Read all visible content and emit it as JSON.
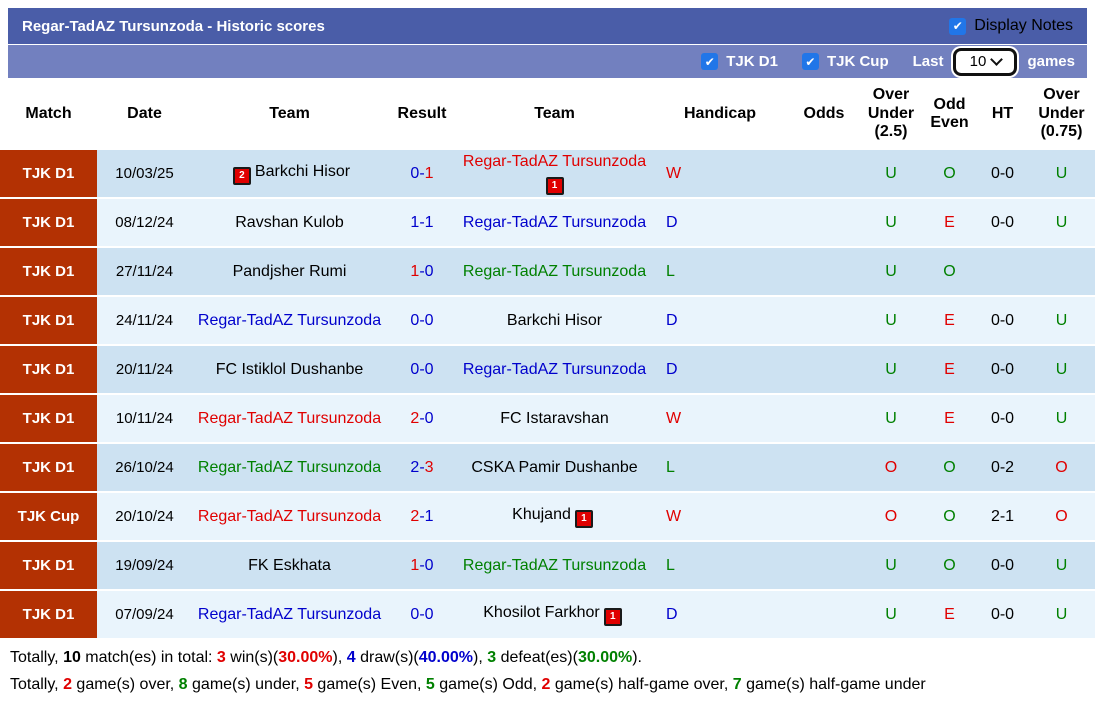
{
  "header": {
    "title": "Regar-TadAZ Tursunzoda - Historic scores",
    "display_notes_label": "Display Notes",
    "display_notes_checked": true
  },
  "filter_bar": {
    "league1_label": "TJK D1",
    "league1_checked": true,
    "league2_label": "TJK Cup",
    "league2_checked": true,
    "last_label": "Last",
    "last_value": "10",
    "games_label": "games"
  },
  "colors": {
    "red": "#e00000",
    "blue": "#0000cc",
    "green": "#008000",
    "black": "#000000",
    "bar_top": "#4a5da8",
    "bar_bottom": "#7280bf",
    "league_cell_bg": "#b33103",
    "row_dark": "#cde2f2",
    "row_light": "#e9f4fc",
    "checkbox_blue": "#2176e8"
  },
  "columns": [
    "Match",
    "Date",
    "Team",
    "Result",
    "Team",
    "Handicap",
    "Odds",
    "Over Under (2.5)",
    "Odd Even",
    "HT",
    "Over Under (0.75)"
  ],
  "rows": [
    {
      "league": "TJK D1",
      "date": "10/03/25",
      "home": {
        "name": "Barkchi Hisor",
        "color": "black",
        "badge": "2",
        "badge_side": "left"
      },
      "result": {
        "home": "0",
        "away": "1",
        "home_color": "blue",
        "away_color": "red"
      },
      "away": {
        "name": "Regar-TadAZ Tursunzoda",
        "color": "red",
        "badge": "1",
        "badge_side": "right"
      },
      "handicap": {
        "text": "W",
        "color": "red"
      },
      "odds": "",
      "ou25": {
        "text": "U",
        "color": "green"
      },
      "odd_even": {
        "text": "O",
        "color": "green"
      },
      "ht": "0-0",
      "ou075": {
        "text": "U",
        "color": "green"
      }
    },
    {
      "league": "TJK D1",
      "date": "08/12/24",
      "home": {
        "name": "Ravshan Kulob",
        "color": "black",
        "badge": null,
        "badge_side": null
      },
      "result": {
        "home": "1",
        "away": "1",
        "home_color": "blue",
        "away_color": "blue"
      },
      "away": {
        "name": "Regar-TadAZ Tursunzoda",
        "color": "blue",
        "badge": null,
        "badge_side": null
      },
      "handicap": {
        "text": "D",
        "color": "blue"
      },
      "odds": "",
      "ou25": {
        "text": "U",
        "color": "green"
      },
      "odd_even": {
        "text": "E",
        "color": "red"
      },
      "ht": "0-0",
      "ou075": {
        "text": "U",
        "color": "green"
      }
    },
    {
      "league": "TJK D1",
      "date": "27/11/24",
      "home": {
        "name": "Pandjsher Rumi",
        "color": "black",
        "badge": null,
        "badge_side": null
      },
      "result": {
        "home": "1",
        "away": "0",
        "home_color": "red",
        "away_color": "blue"
      },
      "away": {
        "name": "Regar-TadAZ Tursunzoda",
        "color": "green",
        "badge": null,
        "badge_side": null
      },
      "handicap": {
        "text": "L",
        "color": "green"
      },
      "odds": "",
      "ou25": {
        "text": "U",
        "color": "green"
      },
      "odd_even": {
        "text": "O",
        "color": "green"
      },
      "ht": "",
      "ou075": {
        "text": "",
        "color": "black"
      }
    },
    {
      "league": "TJK D1",
      "date": "24/11/24",
      "home": {
        "name": "Regar-TadAZ Tursunzoda",
        "color": "blue",
        "badge": null,
        "badge_side": null
      },
      "result": {
        "home": "0",
        "away": "0",
        "home_color": "blue",
        "away_color": "blue"
      },
      "away": {
        "name": "Barkchi Hisor",
        "color": "black",
        "badge": null,
        "badge_side": null
      },
      "handicap": {
        "text": "D",
        "color": "blue"
      },
      "odds": "",
      "ou25": {
        "text": "U",
        "color": "green"
      },
      "odd_even": {
        "text": "E",
        "color": "red"
      },
      "ht": "0-0",
      "ou075": {
        "text": "U",
        "color": "green"
      }
    },
    {
      "league": "TJK D1",
      "date": "20/11/24",
      "home": {
        "name": "FC Istiklol Dushanbe",
        "color": "black",
        "badge": null,
        "badge_side": null
      },
      "result": {
        "home": "0",
        "away": "0",
        "home_color": "blue",
        "away_color": "blue"
      },
      "away": {
        "name": "Regar-TadAZ Tursunzoda",
        "color": "blue",
        "badge": null,
        "badge_side": null
      },
      "handicap": {
        "text": "D",
        "color": "blue"
      },
      "odds": "",
      "ou25": {
        "text": "U",
        "color": "green"
      },
      "odd_even": {
        "text": "E",
        "color": "red"
      },
      "ht": "0-0",
      "ou075": {
        "text": "U",
        "color": "green"
      }
    },
    {
      "league": "TJK D1",
      "date": "10/11/24",
      "home": {
        "name": "Regar-TadAZ Tursunzoda",
        "color": "red",
        "badge": null,
        "badge_side": null
      },
      "result": {
        "home": "2",
        "away": "0",
        "home_color": "red",
        "away_color": "blue"
      },
      "away": {
        "name": "FC Istaravshan",
        "color": "black",
        "badge": null,
        "badge_side": null
      },
      "handicap": {
        "text": "W",
        "color": "red"
      },
      "odds": "",
      "ou25": {
        "text": "U",
        "color": "green"
      },
      "odd_even": {
        "text": "E",
        "color": "red"
      },
      "ht": "0-0",
      "ou075": {
        "text": "U",
        "color": "green"
      }
    },
    {
      "league": "TJK D1",
      "date": "26/10/24",
      "home": {
        "name": "Regar-TadAZ Tursunzoda",
        "color": "green",
        "badge": null,
        "badge_side": null
      },
      "result": {
        "home": "2",
        "away": "3",
        "home_color": "blue",
        "away_color": "red"
      },
      "away": {
        "name": "CSKA Pamir Dushanbe",
        "color": "black",
        "badge": null,
        "badge_side": null
      },
      "handicap": {
        "text": "L",
        "color": "green"
      },
      "odds": "",
      "ou25": {
        "text": "O",
        "color": "red"
      },
      "odd_even": {
        "text": "O",
        "color": "green"
      },
      "ht": "0-2",
      "ou075": {
        "text": "O",
        "color": "red"
      }
    },
    {
      "league": "TJK Cup",
      "date": "20/10/24",
      "home": {
        "name": "Regar-TadAZ Tursunzoda",
        "color": "red",
        "badge": null,
        "badge_side": null
      },
      "result": {
        "home": "2",
        "away": "1",
        "home_color": "red",
        "away_color": "blue"
      },
      "away": {
        "name": "Khujand",
        "color": "black",
        "badge": "1",
        "badge_side": "right"
      },
      "handicap": {
        "text": "W",
        "color": "red"
      },
      "odds": "",
      "ou25": {
        "text": "O",
        "color": "red"
      },
      "odd_even": {
        "text": "O",
        "color": "green"
      },
      "ht": "2-1",
      "ou075": {
        "text": "O",
        "color": "red"
      }
    },
    {
      "league": "TJK D1",
      "date": "19/09/24",
      "home": {
        "name": "FK Eskhata",
        "color": "black",
        "badge": null,
        "badge_side": null
      },
      "result": {
        "home": "1",
        "away": "0",
        "home_color": "red",
        "away_color": "blue"
      },
      "away": {
        "name": "Regar-TadAZ Tursunzoda",
        "color": "green",
        "badge": null,
        "badge_side": null
      },
      "handicap": {
        "text": "L",
        "color": "green"
      },
      "odds": "",
      "ou25": {
        "text": "U",
        "color": "green"
      },
      "odd_even": {
        "text": "O",
        "color": "green"
      },
      "ht": "0-0",
      "ou075": {
        "text": "U",
        "color": "green"
      }
    },
    {
      "league": "TJK D1",
      "date": "07/09/24",
      "home": {
        "name": "Regar-TadAZ Tursunzoda",
        "color": "blue",
        "badge": null,
        "badge_side": null
      },
      "result": {
        "home": "0",
        "away": "0",
        "home_color": "blue",
        "away_color": "blue"
      },
      "away": {
        "name": "Khosilot Farkhor",
        "color": "black",
        "badge": "1",
        "badge_side": "right"
      },
      "handicap": {
        "text": "D",
        "color": "blue"
      },
      "odds": "",
      "ou25": {
        "text": "U",
        "color": "green"
      },
      "odd_even": {
        "text": "E",
        "color": "red"
      },
      "ht": "0-0",
      "ou075": {
        "text": "U",
        "color": "green"
      }
    }
  ],
  "footer": {
    "line1": [
      {
        "t": "Totally, ",
        "c": "black",
        "b": false
      },
      {
        "t": "10",
        "c": "black",
        "b": true
      },
      {
        "t": " match(es) in total: ",
        "c": "black",
        "b": false
      },
      {
        "t": "3",
        "c": "red",
        "b": true
      },
      {
        "t": " win(s)(",
        "c": "black",
        "b": false
      },
      {
        "t": "30.00%",
        "c": "red",
        "b": true
      },
      {
        "t": "), ",
        "c": "black",
        "b": false
      },
      {
        "t": "4",
        "c": "blue",
        "b": true
      },
      {
        "t": " draw(s)(",
        "c": "black",
        "b": false
      },
      {
        "t": "40.00%",
        "c": "blue",
        "b": true
      },
      {
        "t": "), ",
        "c": "black",
        "b": false
      },
      {
        "t": "3",
        "c": "green",
        "b": true
      },
      {
        "t": " defeat(es)(",
        "c": "black",
        "b": false
      },
      {
        "t": "30.00%",
        "c": "green",
        "b": true
      },
      {
        "t": ").",
        "c": "black",
        "b": false
      }
    ],
    "line2": [
      {
        "t": "Totally, ",
        "c": "black",
        "b": false
      },
      {
        "t": "2",
        "c": "red",
        "b": true
      },
      {
        "t": " game(s) over, ",
        "c": "black",
        "b": false
      },
      {
        "t": "8",
        "c": "green",
        "b": true
      },
      {
        "t": " game(s) under, ",
        "c": "black",
        "b": false
      },
      {
        "t": "5",
        "c": "red",
        "b": true
      },
      {
        "t": " game(s) Even, ",
        "c": "black",
        "b": false
      },
      {
        "t": "5",
        "c": "green",
        "b": true
      },
      {
        "t": " game(s) Odd, ",
        "c": "black",
        "b": false
      },
      {
        "t": "2",
        "c": "red",
        "b": true
      },
      {
        "t": " game(s) half-game over, ",
        "c": "black",
        "b": false
      },
      {
        "t": "7",
        "c": "green",
        "b": true
      },
      {
        "t": " game(s) half-game under",
        "c": "black",
        "b": false
      }
    ]
  }
}
